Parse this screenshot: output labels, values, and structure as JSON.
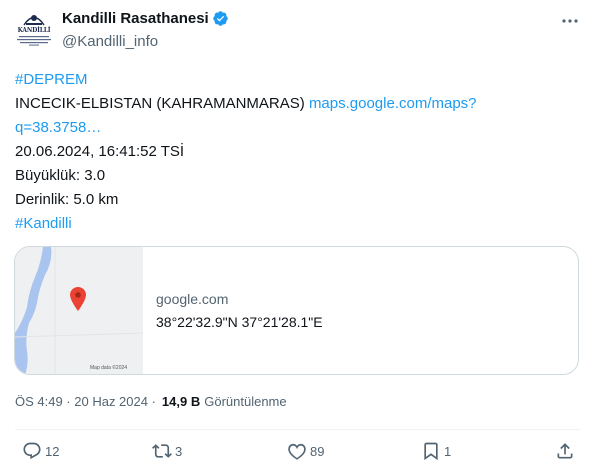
{
  "author": {
    "display_name": "Kandilli Rasathanesi",
    "handle": "@Kandilli_info",
    "avatar_text": "KANDİLLİ",
    "verified_color": "#1d9bf0"
  },
  "tweet": {
    "hashtag1": "#DEPREM",
    "location_text": "INCECIK-ELBISTAN (KAHRAMANMARAS) ",
    "map_link_1": "maps.google.com/maps?",
    "map_link_2": "q=38.3758…",
    "datetime": "20.06.2024, 16:41:52 TSİ",
    "magnitude": "Büyüklük: 3.0",
    "depth": "Derinlik: 5.0 km",
    "hashtag2": "#Kandilli"
  },
  "card": {
    "domain": "google.com",
    "title": "38°22'32.9\"N 37°21'28.1\"E",
    "map_credit": "Map data ©2024"
  },
  "meta": {
    "time": "ÖS 4:49 · 20 Haz 2024 · ",
    "views_count": "14,9 B",
    "views_label": "Görüntülenme"
  },
  "actions": {
    "reply_count": "12",
    "retweet_count": "3",
    "like_count": "89",
    "bookmark_count": "1"
  },
  "colors": {
    "link": "#1d9bf0",
    "secondary_text": "#536471",
    "primary_text": "#0f1419",
    "pin": "#ea4335",
    "water": "#aac4f0"
  },
  "icons": [
    "verified-badge-icon",
    "more-icon",
    "map-pin-icon",
    "reply-icon",
    "retweet-icon",
    "like-icon",
    "bookmark-icon",
    "share-icon"
  ]
}
